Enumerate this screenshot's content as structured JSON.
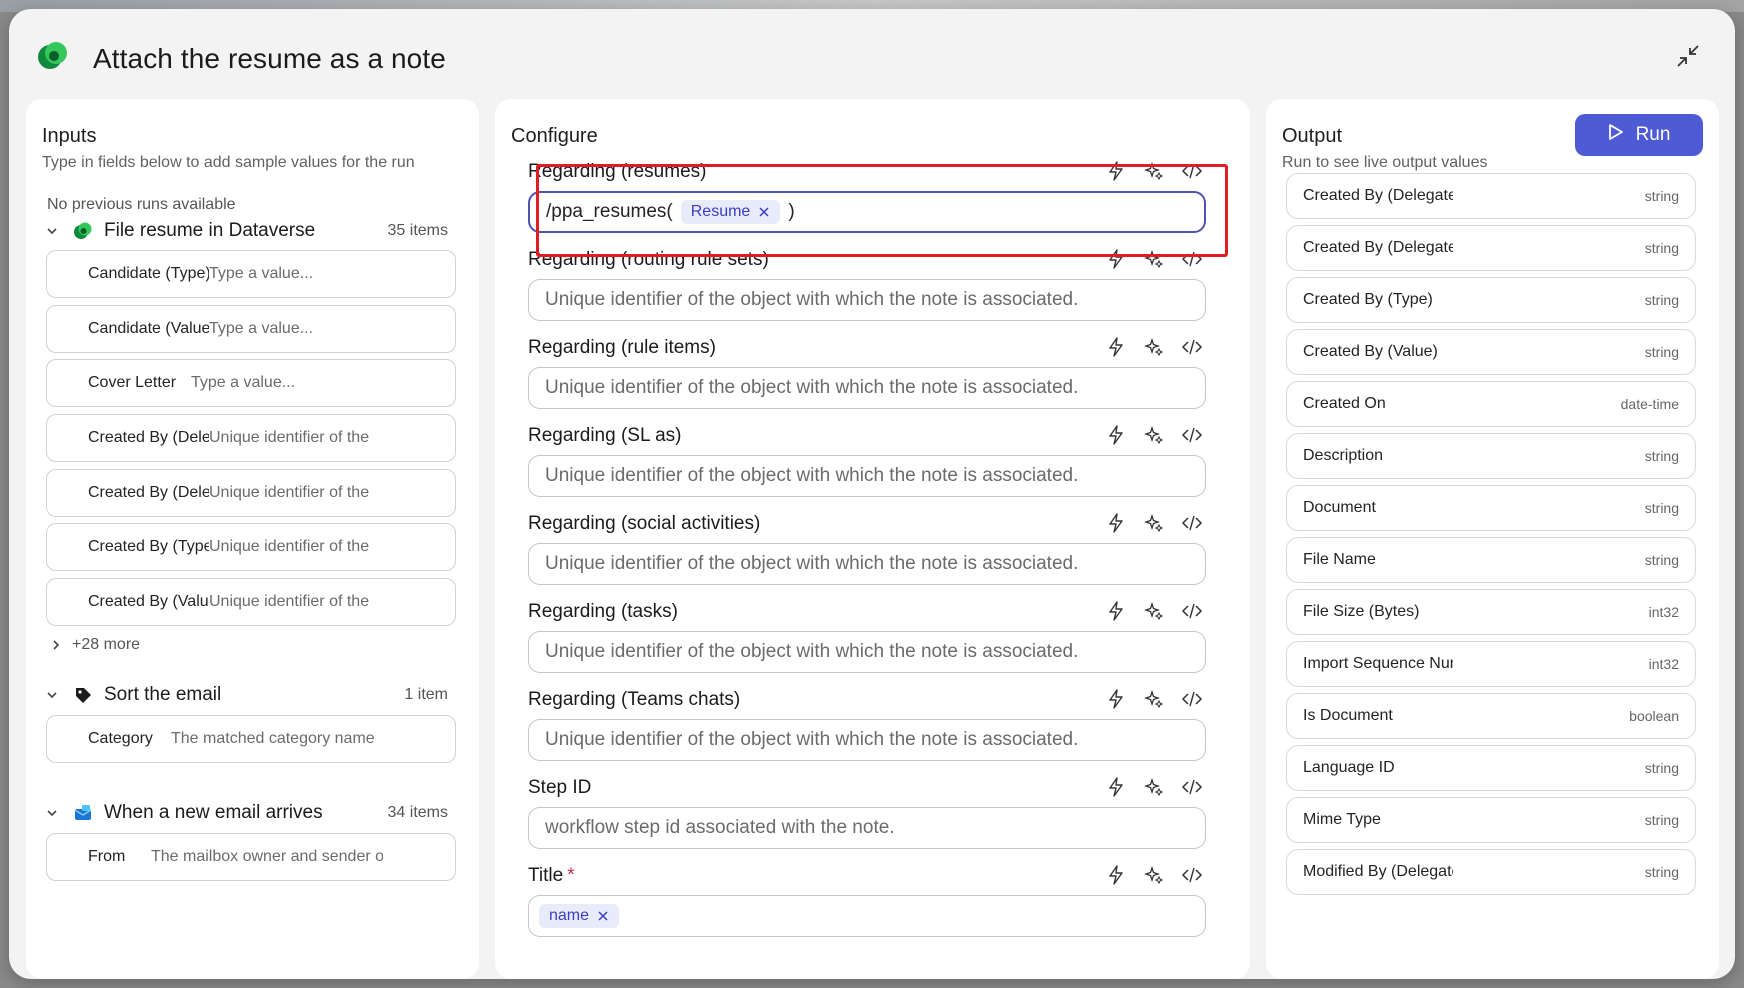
{
  "dialog": {
    "title": "Attach the resume as a note"
  },
  "inputs": {
    "title": "Inputs",
    "subtitle": "Type in fields below to add sample values for the run",
    "no_runs": "No previous runs available",
    "groups": [
      {
        "name": "File resume in Dataverse",
        "count": "35 items",
        "fields": [
          {
            "label": "Candidate (Type)",
            "value": "Type a value..."
          },
          {
            "label": "Candidate (Value",
            "value": "Type a value..."
          },
          {
            "label": "Cover Letter",
            "value": "Type a value..."
          },
          {
            "label": "Created By (Dele",
            "value": "Unique identifier of the"
          },
          {
            "label": "Created By (Dele",
            "value": "Unique identifier of the"
          },
          {
            "label": "Created By (Type",
            "value": "Unique identifier of the"
          },
          {
            "label": "Created By (Value",
            "value": "Unique identifier of the"
          }
        ],
        "more": "+28 more"
      },
      {
        "name": "Sort the email",
        "count": "1 item",
        "fields": [
          {
            "label": "Category",
            "value": "The matched category name"
          }
        ]
      },
      {
        "name": "When a new email arrives",
        "count": "34 items",
        "fields": [
          {
            "label": "From",
            "value": "The mailbox owner and sender o"
          }
        ]
      }
    ]
  },
  "configure": {
    "title": "Configure",
    "fields": [
      {
        "label": "Regarding (resumes)",
        "prefix": "/ppa_resumes(",
        "token": "Resume",
        "suffix": ")"
      },
      {
        "label": "Regarding (routing rule sets)",
        "placeholder": "Unique identifier of the object with which the note is associated."
      },
      {
        "label": "Regarding (rule items)",
        "placeholder": "Unique identifier of the object with which the note is associated."
      },
      {
        "label": "Regarding (SL as)",
        "placeholder": "Unique identifier of the object with which the note is associated."
      },
      {
        "label": "Regarding (social activities)",
        "placeholder": "Unique identifier of the object with which the note is associated."
      },
      {
        "label": "Regarding (tasks)",
        "placeholder": "Unique identifier of the object with which the note is associated."
      },
      {
        "label": "Regarding (Teams chats)",
        "placeholder": "Unique identifier of the object with which the note is associated."
      },
      {
        "label": "Step ID",
        "placeholder": "workflow step id associated with the note."
      },
      {
        "label": "Title",
        "required": "*",
        "token": "name"
      }
    ]
  },
  "output": {
    "title": "Output",
    "subtitle": "Run to see live output values",
    "run_label": "Run",
    "items": [
      {
        "name": "Created By (Delegate)",
        "type": "string"
      },
      {
        "name": "Created By (Delegate)",
        "type": "string"
      },
      {
        "name": "Created By (Type)",
        "type": "string"
      },
      {
        "name": "Created By (Value)",
        "type": "string"
      },
      {
        "name": "Created On",
        "type": "date-time"
      },
      {
        "name": "Description",
        "type": "string"
      },
      {
        "name": "Document",
        "type": "string"
      },
      {
        "name": "File Name",
        "type": "string"
      },
      {
        "name": "File Size (Bytes)",
        "type": "int32"
      },
      {
        "name": "Import Sequence Number",
        "type": "int32"
      },
      {
        "name": "Is Document",
        "type": "boolean"
      },
      {
        "name": "Language ID",
        "type": "string"
      },
      {
        "name": "Mime Type",
        "type": "string"
      },
      {
        "name": "Modified By (Delegate)",
        "type": "string"
      }
    ]
  },
  "colors": {
    "accent": "#4f5bd5",
    "highlight": "#e11d23",
    "token_bg": "#e8ebfa"
  }
}
